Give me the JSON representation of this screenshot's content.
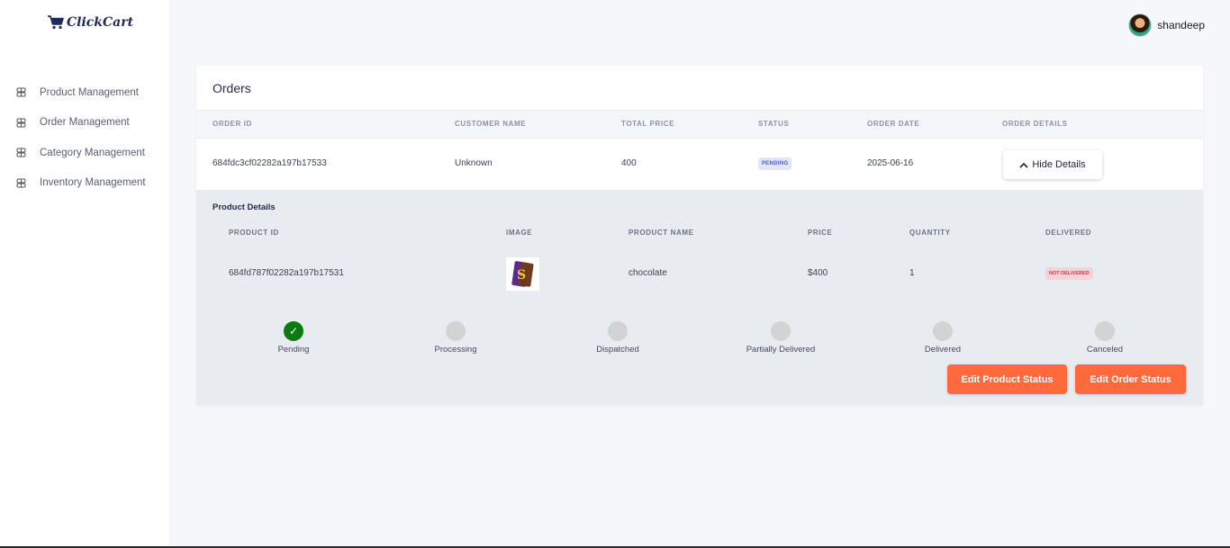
{
  "brand": {
    "name": "ClickCart"
  },
  "user": {
    "name": "shandeep"
  },
  "sidebar": {
    "items": [
      {
        "label": "Product Management"
      },
      {
        "label": "Order Management"
      },
      {
        "label": "Category Management"
      },
      {
        "label": "Inventory Management"
      }
    ]
  },
  "orders": {
    "title": "Orders",
    "columns": [
      "ORDER ID",
      "CUSTOMER NAME",
      "TOTAL PRICE",
      "STATUS",
      "ORDER DATE",
      "ORDER DETAILS"
    ],
    "rows": [
      {
        "order_id": "684fdc3cf02282a197b17533",
        "customer_name": "Unknown",
        "total_price": "400",
        "status": "PENDING",
        "order_date": "2025-06-16",
        "details_button": "Hide Details"
      }
    ]
  },
  "product_details": {
    "title": "Product Details",
    "columns": [
      "PRODUCT ID",
      "IMAGE",
      "PRODUCT NAME",
      "PRICE",
      "QUANTITY",
      "DELIVERED"
    ],
    "rows": [
      {
        "product_id": "684fd787f02282a197b17531",
        "product_name": "chocolate",
        "price": "$400",
        "quantity": "1",
        "delivered": "NOT DELIVERED"
      }
    ]
  },
  "status_steps": {
    "steps": [
      {
        "label": "Pending",
        "done": true
      },
      {
        "label": "Processing",
        "done": false
      },
      {
        "label": "Dispatched",
        "done": false
      },
      {
        "label": "Partially Delivered",
        "done": false
      },
      {
        "label": "Delivered",
        "done": false
      },
      {
        "label": "Canceled",
        "done": false
      }
    ]
  },
  "actions": {
    "edit_product_status": "Edit Product Status",
    "edit_order_status": "Edit Order Status"
  },
  "colors": {
    "accent": "#ff6a3d",
    "done": "#0e7a12",
    "pending_badge": "#e2e6fb",
    "not_delivered_badge": "#f8d2d8"
  },
  "icons": {
    "logo": "cart-icon",
    "nav": "grid-icon",
    "chevron": "chevron-up-icon",
    "check": "check-icon"
  }
}
